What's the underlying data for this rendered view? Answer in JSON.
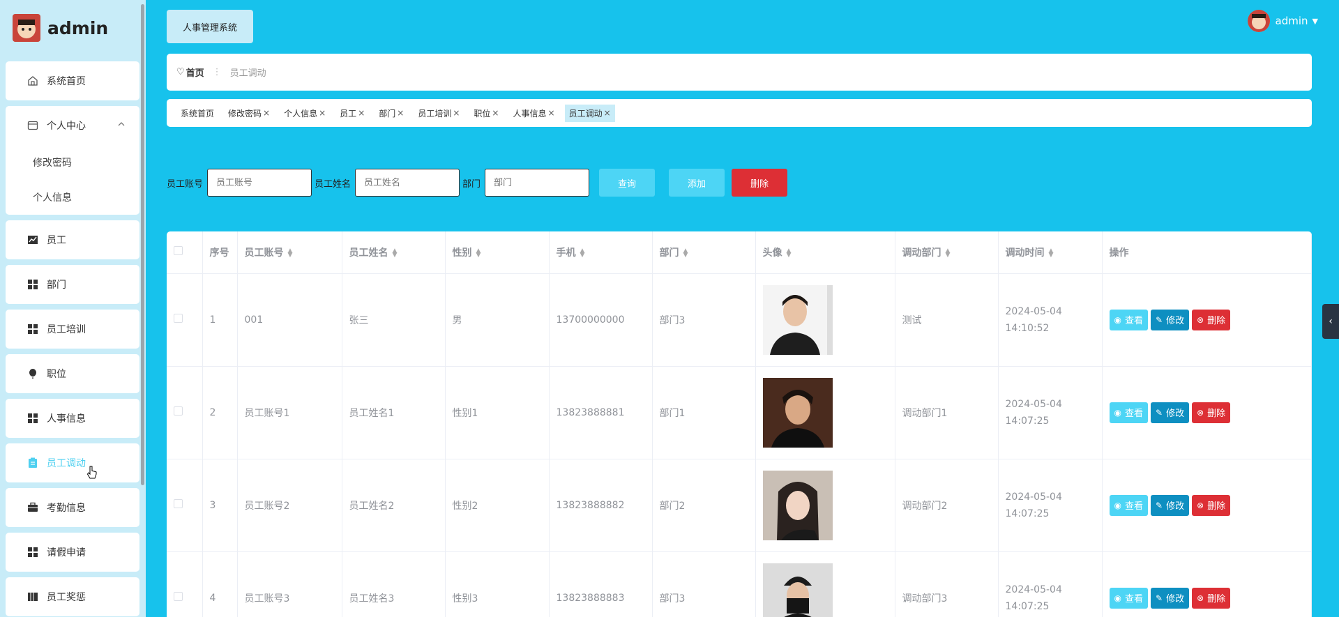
{
  "brand": {
    "name": "admin"
  },
  "sidebar": {
    "items": [
      {
        "label": "系统首页",
        "icon": "home-icon"
      },
      {
        "label": "个人中心",
        "icon": "card-icon",
        "children": [
          "修改密码",
          "个人信息"
        ]
      },
      {
        "label": "员工",
        "icon": "chart-icon"
      },
      {
        "label": "部门",
        "icon": "grid-icon"
      },
      {
        "label": "员工培训",
        "icon": "grid-icon"
      },
      {
        "label": "职位",
        "icon": "balloon-icon"
      },
      {
        "label": "人事信息",
        "icon": "grid-icon"
      },
      {
        "label": "员工调动",
        "icon": "clipboard-icon",
        "active": true
      },
      {
        "label": "考勤信息",
        "icon": "briefcase-icon"
      },
      {
        "label": "请假申请",
        "icon": "grid-icon"
      },
      {
        "label": "员工奖惩",
        "icon": "book-icon"
      }
    ]
  },
  "header": {
    "system_title": "人事管理系统",
    "user": "admin"
  },
  "breadcrumb": {
    "home": "首页",
    "current": "员工调动"
  },
  "tags": [
    "系统首页",
    "修改密码",
    "个人信息",
    "员工",
    "部门",
    "员工培训",
    "职位",
    "人事信息",
    "员工调动"
  ],
  "search": {
    "account_label": "员工账号",
    "account_placeholder": "员工账号",
    "name_label": "员工姓名",
    "name_placeholder": "员工姓名",
    "dept_label": "部门",
    "dept_placeholder": "部门",
    "query": "查询",
    "add": "添加",
    "delete": "删除"
  },
  "table": {
    "headers": [
      "序号",
      "员工账号",
      "员工姓名",
      "性别",
      "手机",
      "部门",
      "头像",
      "调动部门",
      "调动时间",
      "操作"
    ],
    "rows": [
      {
        "no": "1",
        "account": "001",
        "name": "张三",
        "gender": "男",
        "phone": "13700000000",
        "dept": "部门3",
        "transfer": "测试",
        "time": "2024-05-04 14:10:52"
      },
      {
        "no": "2",
        "account": "员工账号1",
        "name": "员工姓名1",
        "gender": "性别1",
        "phone": "13823888881",
        "dept": "部门1",
        "transfer": "调动部门1",
        "time": "2024-05-04 14:07:25"
      },
      {
        "no": "3",
        "account": "员工账号2",
        "name": "员工姓名2",
        "gender": "性别2",
        "phone": "13823888882",
        "dept": "部门2",
        "transfer": "调动部门2",
        "time": "2024-05-04 14:07:25"
      },
      {
        "no": "4",
        "account": "员工账号3",
        "name": "员工姓名3",
        "gender": "性别3",
        "phone": "13823888883",
        "dept": "部门3",
        "transfer": "调动部门3",
        "time": "2024-05-04 14:07:25"
      }
    ],
    "actions": {
      "view": "查看",
      "edit": "修改",
      "delete": "删除"
    }
  },
  "colors": {
    "bg": "#17c2ec",
    "sidebar": "#c8ecf8",
    "active": "#4fd0f0",
    "danger": "#dd2f35",
    "primary": "#0e8fc1"
  }
}
